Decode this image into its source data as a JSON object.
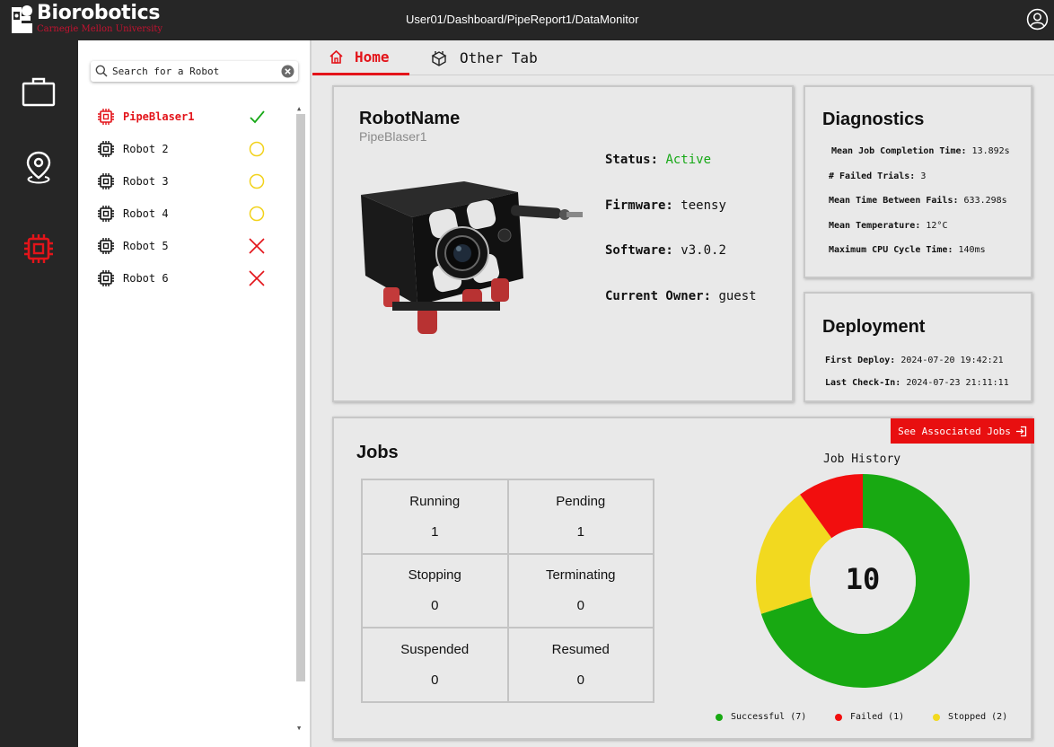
{
  "header": {
    "brand": "Biorobotics",
    "brand_sub": "Carnegie Mellon University",
    "breadcrumb": "User01/Dashboard/PipeReport1/DataMonitor"
  },
  "colors": {
    "accent": "#e3141a",
    "success": "#16a816",
    "pending": "#f2d21b",
    "failed": "#e80f10",
    "stopped": "#f2d21b"
  },
  "rail": [
    "briefcase-icon",
    "location-pin-icon",
    "chip-icon"
  ],
  "robot_list": {
    "search_placeholder": "Search for a Robot",
    "items": [
      {
        "name": "PipeBlaser1",
        "status": "check",
        "selected": true
      },
      {
        "name": "Robot 2",
        "status": "pending",
        "selected": false
      },
      {
        "name": "Robot 3",
        "status": "pending",
        "selected": false
      },
      {
        "name": "Robot 4",
        "status": "pending",
        "selected": false
      },
      {
        "name": "Robot 5",
        "status": "error",
        "selected": false
      },
      {
        "name": "Robot 6",
        "status": "error",
        "selected": false
      }
    ]
  },
  "tabs": [
    {
      "label": "Home",
      "active": true
    },
    {
      "label": "Other Tab",
      "active": false
    }
  ],
  "robot": {
    "title": "RobotName",
    "subtitle": "PipeBlaser1",
    "status_label": "Status:",
    "status_value": "Active",
    "firmware_label": "Firmware:",
    "firmware_value": "teensy",
    "software_label": "Software:",
    "software_value": "v3.0.2",
    "owner_label": "Current Owner:",
    "owner_value": "guest"
  },
  "diagnostics": {
    "title": "Diagnostics",
    "rows": [
      {
        "label": "Mean Job Completion Time:",
        "value": "13.892s"
      },
      {
        "label": "# Failed Trials:",
        "value": "3"
      },
      {
        "label": "Mean Time Between Fails:",
        "value": "633.298s"
      },
      {
        "label": "Mean Temperature:",
        "value": "12°C"
      },
      {
        "label": "Maximum CPU Cycle Time:",
        "value": "140ms"
      }
    ]
  },
  "deployment": {
    "title": "Deployment",
    "rows": [
      {
        "label": "First Deploy:",
        "value": "2024-07-20 19:42:21"
      },
      {
        "label": "Last Check-In:",
        "value": "2024-07-23 21:11:11"
      }
    ]
  },
  "jobs": {
    "title": "Jobs",
    "see_jobs_label": "See Associated Jobs",
    "cells": [
      {
        "label": "Running",
        "count": "1"
      },
      {
        "label": "Pending",
        "count": "1"
      },
      {
        "label": "Stopping",
        "count": "0"
      },
      {
        "label": "Terminating",
        "count": "0"
      },
      {
        "label": "Suspended",
        "count": "0"
      },
      {
        "label": "Resumed",
        "count": "0"
      }
    ]
  },
  "chart_data": {
    "type": "pie",
    "title": "Job History",
    "center_label": "10",
    "categories": [
      "Successful (7)",
      "Failed (1)",
      "Stopped (2)"
    ],
    "values": [
      7,
      1,
      2
    ],
    "colors": [
      "#18a912",
      "#f20e0e",
      "#f2d91f"
    ],
    "donut": true
  }
}
